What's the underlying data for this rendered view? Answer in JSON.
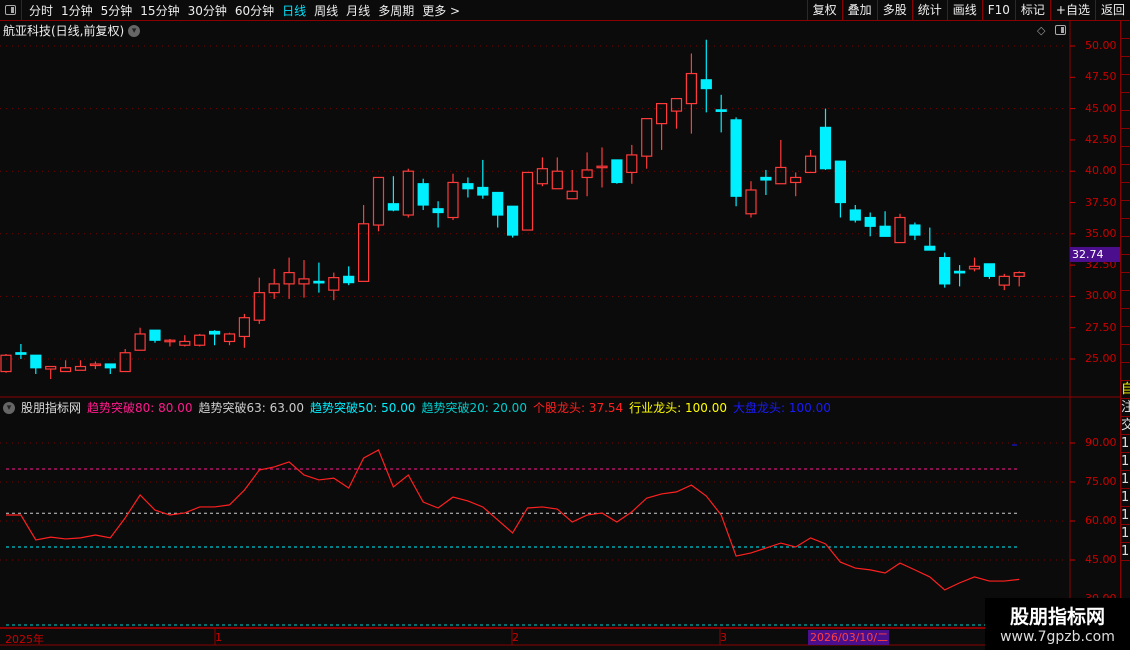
{
  "topbar": {
    "periods": [
      "分时",
      "1分钟",
      "5分钟",
      "15分钟",
      "30分钟",
      "60分钟",
      "日线",
      "周线",
      "月线",
      "多周期",
      "更多 >"
    ],
    "active": "日线",
    "tools": [
      "复权",
      "叠加",
      "多股",
      "统计",
      "画线",
      "F10",
      "标记",
      "+自选",
      "返回"
    ]
  },
  "stock_title": "航亚科技(日线,前复权)",
  "price_axis": [
    "50.00",
    "47.50",
    "45.00",
    "42.50",
    "40.00",
    "37.50",
    "35.00",
    "32.50",
    "30.00",
    "27.50",
    "25.00"
  ],
  "current_price": "32.74",
  "colors": {
    "up": "#ff3b3b",
    "down": "#00f0ff",
    "grid": "#7a0000",
    "axis": "#cc0000",
    "highlight": "#4b0e8c"
  },
  "candles": [
    [
      24.0,
      25.4,
      23.9,
      25.3
    ],
    [
      25.5,
      26.2,
      25.0,
      25.4
    ],
    [
      25.3,
      25.3,
      23.8,
      24.3
    ],
    [
      24.2,
      24.4,
      23.4,
      24.4
    ],
    [
      24.0,
      24.9,
      24.0,
      24.3
    ],
    [
      24.1,
      24.9,
      24.1,
      24.4
    ],
    [
      24.5,
      24.8,
      24.2,
      24.6
    ],
    [
      24.6,
      24.6,
      23.8,
      24.3
    ],
    [
      24.0,
      25.8,
      24.0,
      25.5
    ],
    [
      25.7,
      27.5,
      25.7,
      27.0
    ],
    [
      27.3,
      27.3,
      26.3,
      26.5
    ],
    [
      26.5,
      26.6,
      26.0,
      26.5
    ],
    [
      26.1,
      26.9,
      26.0,
      26.4
    ],
    [
      26.1,
      27.0,
      26.0,
      26.9
    ],
    [
      27.2,
      27.3,
      26.1,
      27.0
    ],
    [
      26.4,
      27.1,
      26.1,
      27.0
    ],
    [
      26.8,
      28.6,
      25.9,
      28.3
    ],
    [
      28.1,
      31.5,
      27.8,
      30.3
    ],
    [
      30.3,
      32.2,
      29.8,
      31.0
    ],
    [
      31.0,
      33.1,
      29.8,
      31.9
    ],
    [
      31.0,
      32.9,
      29.9,
      31.4
    ],
    [
      31.2,
      32.7,
      30.3,
      31.1
    ],
    [
      30.5,
      31.9,
      29.7,
      31.5
    ],
    [
      31.6,
      32.4,
      30.9,
      31.1
    ],
    [
      31.2,
      37.3,
      31.2,
      35.8
    ],
    [
      35.7,
      39.5,
      35.2,
      39.5
    ],
    [
      37.4,
      39.6,
      36.8,
      36.9
    ],
    [
      36.5,
      40.2,
      36.3,
      40.0
    ],
    [
      39.0,
      39.4,
      36.9,
      37.3
    ],
    [
      37.0,
      37.6,
      35.5,
      36.7
    ],
    [
      36.3,
      39.8,
      36.1,
      39.1
    ],
    [
      39.0,
      39.5,
      37.9,
      38.6
    ],
    [
      38.7,
      40.9,
      37.8,
      38.1
    ],
    [
      38.3,
      38.3,
      35.5,
      36.5
    ],
    [
      37.2,
      37.2,
      34.7,
      34.9
    ],
    [
      35.3,
      39.9,
      35.3,
      39.9
    ],
    [
      39.0,
      41.1,
      38.8,
      40.2
    ],
    [
      38.6,
      41.1,
      38.6,
      40.0
    ],
    [
      37.8,
      40.1,
      37.8,
      38.4
    ],
    [
      39.5,
      41.5,
      38.0,
      40.1
    ],
    [
      40.3,
      41.9,
      38.7,
      40.4
    ],
    [
      40.9,
      40.9,
      39.0,
      39.1
    ],
    [
      39.9,
      42.1,
      39.0,
      41.3
    ],
    [
      41.2,
      44.2,
      40.2,
      44.2
    ],
    [
      43.8,
      45.4,
      41.7,
      45.4
    ],
    [
      44.8,
      45.8,
      43.4,
      45.8
    ],
    [
      45.4,
      49.4,
      43.0,
      47.8
    ],
    [
      47.3,
      50.5,
      44.7,
      46.6
    ],
    [
      44.9,
      46.1,
      43.1,
      44.85
    ],
    [
      44.1,
      44.3,
      37.2,
      38.0
    ],
    [
      36.6,
      39.2,
      36.3,
      38.5
    ],
    [
      39.5,
      40.1,
      38.1,
      39.3
    ],
    [
      39.0,
      42.5,
      39.0,
      40.3
    ],
    [
      39.1,
      39.9,
      38.0,
      39.5
    ],
    [
      39.9,
      41.7,
      39.9,
      41.2
    ],
    [
      43.5,
      45.0,
      40.1,
      40.2
    ],
    [
      40.8,
      40.8,
      36.3,
      37.5
    ],
    [
      36.9,
      37.3,
      35.9,
      36.1
    ],
    [
      36.3,
      36.7,
      34.8,
      35.6
    ],
    [
      35.6,
      36.8,
      34.8,
      34.8
    ],
    [
      34.3,
      36.6,
      34.3,
      36.3
    ],
    [
      35.7,
      35.9,
      34.5,
      34.9
    ],
    [
      34.0,
      35.5,
      33.7,
      33.7
    ],
    [
      33.1,
      33.5,
      30.7,
      31.0
    ],
    [
      32.0,
      32.5,
      30.8,
      31.9
    ],
    [
      32.2,
      33.1,
      32.0,
      32.4
    ],
    [
      32.6,
      32.6,
      31.4,
      31.6
    ],
    [
      30.9,
      31.8,
      30.5,
      31.6
    ],
    [
      31.6,
      32.0,
      30.8,
      31.9
    ]
  ],
  "sub_indicator": {
    "name": "股朋指标网",
    "legend": [
      {
        "label": "趋势突破80: 80.00",
        "color": "#ff1a8c",
        "value": 80
      },
      {
        "label": "趋势突破63: 63.00",
        "color": "#cccccc",
        "value": 63
      },
      {
        "label": "趋势突破50: 50.00",
        "color": "#00f0ff",
        "value": 50
      },
      {
        "label": "趋势突破20: 20.00",
        "color": "#00cccc",
        "value": 20
      },
      {
        "label": "个股龙头: 37.54",
        "color": "#ff2020"
      },
      {
        "label": "行业龙头: 100.00",
        "color": "#ffff00"
      },
      {
        "label": "大盘龙头: 100.00",
        "color": "#1a1aff"
      }
    ],
    "axis": [
      "90.00",
      "75.00",
      "60.00",
      "45.00",
      "30.00"
    ],
    "gegu_longtou": [
      62.3,
      62.3,
      52.7,
      53.8,
      53.1,
      53.5,
      54.6,
      53.5,
      61.2,
      70.0,
      64.2,
      62.3,
      63.1,
      65.4,
      65.4,
      66.2,
      71.9,
      79.6,
      80.8,
      82.7,
      77.7,
      75.8,
      76.5,
      72.7,
      84.2,
      87.3,
      73.1,
      77.7,
      67.3,
      65.0,
      69.2,
      67.7,
      65.4,
      60.4,
      55.4,
      65.0,
      65.4,
      64.6,
      59.6,
      62.3,
      63.1,
      59.6,
      63.5,
      68.8,
      70.4,
      71.2,
      73.8,
      69.6,
      62.3,
      46.5,
      47.7,
      49.6,
      51.5,
      50.0,
      53.5,
      51.2,
      44.2,
      41.9,
      41.2,
      40.0,
      43.8,
      41.2,
      38.5,
      33.5,
      36.2,
      38.5,
      36.9,
      36.9,
      37.54
    ]
  },
  "date_axis": {
    "labels": [
      "2025年",
      "1",
      "2",
      "3"
    ],
    "highlight": "2026/03/10/二"
  },
  "side_column": [
    "自",
    "注",
    "交",
    "1",
    "1",
    "1",
    "1",
    "1",
    "1",
    "1"
  ],
  "watermark": {
    "title": "股朋指标网",
    "url": "www.7gpzb.com"
  }
}
